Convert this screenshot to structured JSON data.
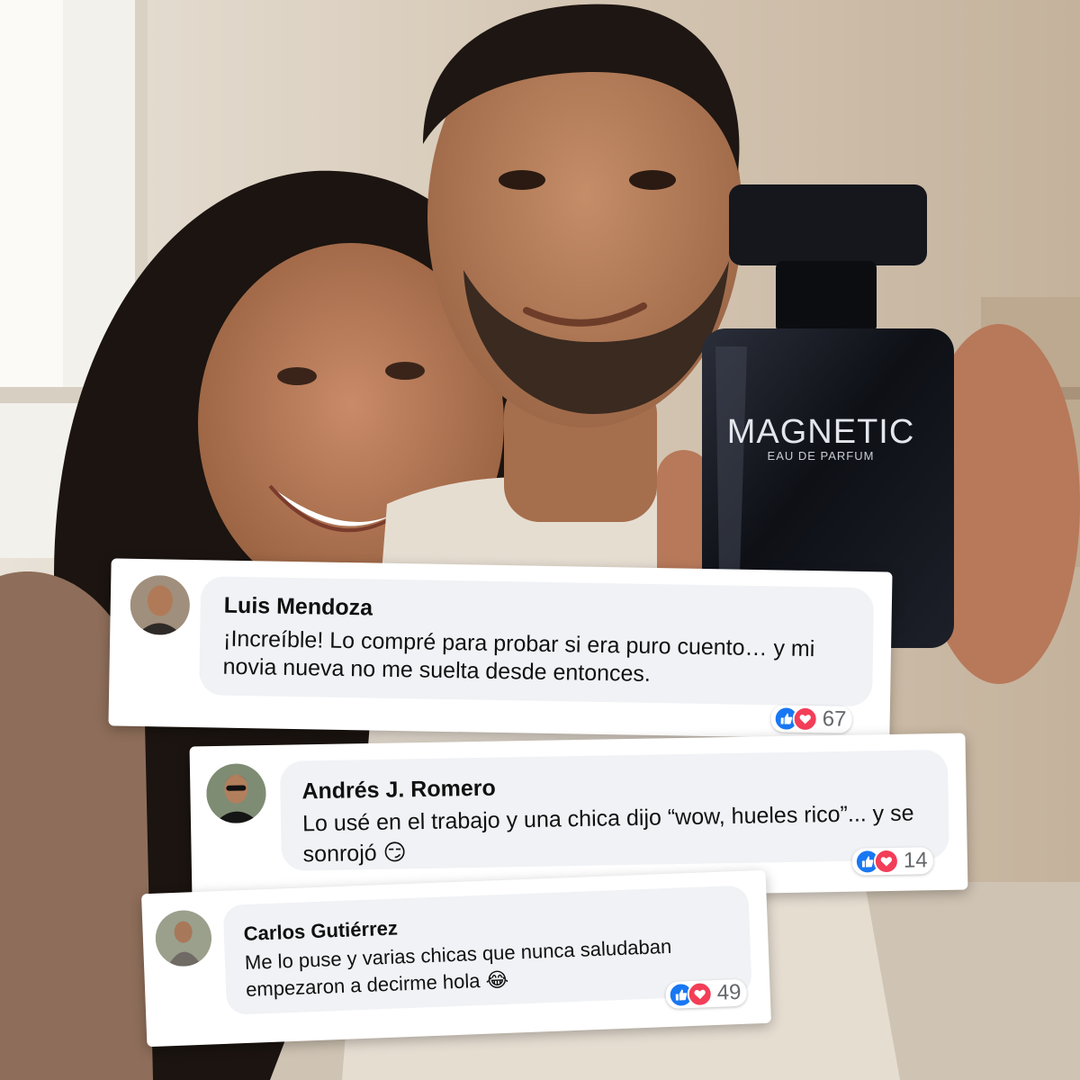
{
  "product": {
    "brand": "MAGNETIC",
    "subtitle": "EAU DE PARFUM"
  },
  "comments": [
    {
      "name": "Luis Mendoza",
      "text": "¡Increíble! Lo compré para probar si era puro cuento… y mi novia nueva no me suelta desde entonces.",
      "reaction_count": "67",
      "reactions": [
        "like-icon",
        "heart-icon"
      ]
    },
    {
      "name": "Andrés J. Romero",
      "text": "Lo usé en el trabajo y una chica dijo “wow, hueles rico”... y se sonrojó",
      "emoji": "😏",
      "reaction_count": "14",
      "reactions": [
        "like-icon",
        "heart-icon"
      ]
    },
    {
      "name": "Carlos Gutiérrez",
      "text": "Me lo puse y varias chicas que nunca saludaban empezaron a decirme hola",
      "emoji": "😂",
      "reaction_count": "49",
      "reactions": [
        "like-icon",
        "heart-icon"
      ]
    }
  ],
  "colors": {
    "like_blue": "#1877f2",
    "heart_red": "#f33e58",
    "bubble_gray": "#f0f2f5",
    "count_gray": "#65676b"
  }
}
